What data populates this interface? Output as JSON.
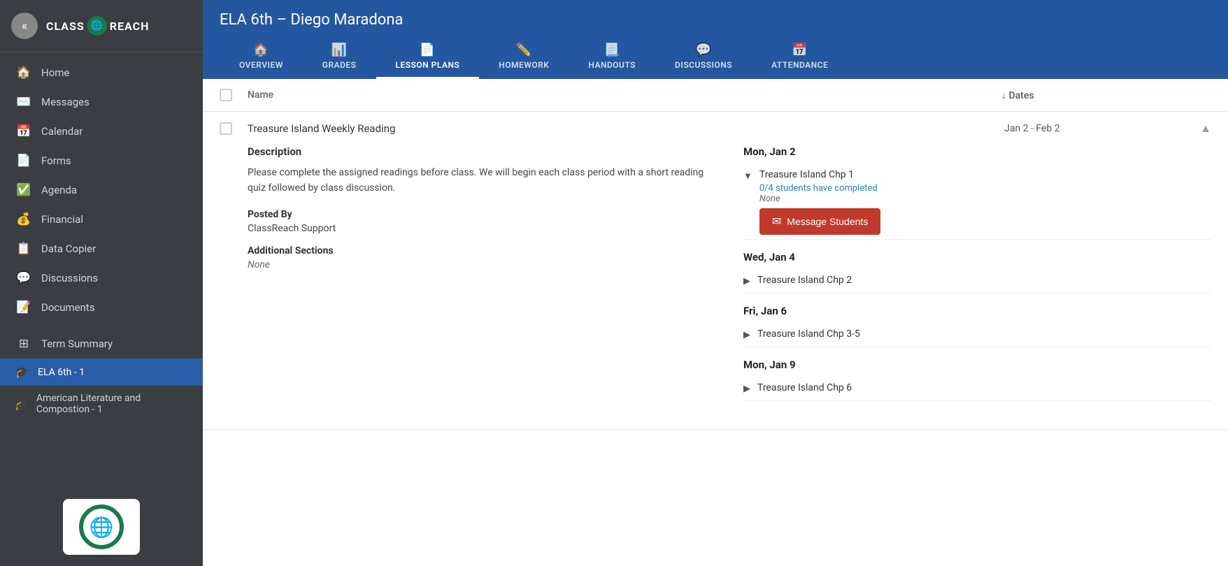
{
  "app": {
    "name": "CLASS REACH",
    "logo_symbol": "🌐"
  },
  "sidebar": {
    "back_title": "«",
    "nav_items": [
      {
        "id": "home",
        "label": "Home",
        "icon": "🏠"
      },
      {
        "id": "messages",
        "label": "Messages",
        "icon": "✉️"
      },
      {
        "id": "calendar",
        "label": "Calendar",
        "icon": "📅"
      },
      {
        "id": "forms",
        "label": "Forms",
        "icon": "📄"
      },
      {
        "id": "agenda",
        "label": "Agenda",
        "icon": "✅"
      },
      {
        "id": "financial",
        "label": "Financial",
        "icon": "💰"
      },
      {
        "id": "data_copier",
        "label": "Data Copier",
        "icon": "📋"
      },
      {
        "id": "discussions",
        "label": "Discussions",
        "icon": "💬"
      },
      {
        "id": "documents",
        "label": "Documents",
        "icon": "📝"
      }
    ],
    "term_summary_label": "Term Summary",
    "classes": [
      {
        "id": "ela6",
        "label": "ELA 6th - 1",
        "active": true
      },
      {
        "id": "amlit",
        "label": "American Literature and Compostion - 1",
        "active": false
      }
    ]
  },
  "header": {
    "title": "ELA 6th – Diego Maradona",
    "tabs": [
      {
        "id": "overview",
        "label": "OVERVIEW",
        "icon": "🏠"
      },
      {
        "id": "grades",
        "label": "GRADES",
        "icon": "📊"
      },
      {
        "id": "lesson_plans",
        "label": "LESSON PLANS",
        "icon": "📄",
        "active": true
      },
      {
        "id": "homework",
        "label": "HOMEWORK",
        "icon": "✏️"
      },
      {
        "id": "handouts",
        "label": "HANDOUTS",
        "icon": "📃"
      },
      {
        "id": "discussions",
        "label": "DISCUSSIONS",
        "icon": "💬"
      },
      {
        "id": "attendance",
        "label": "ATTENDANCE",
        "icon": "📅"
      }
    ]
  },
  "table": {
    "col_name": "Name",
    "col_dates_label": "↓ Dates"
  },
  "lesson": {
    "name": "Treasure Island Weekly Reading",
    "dates": "Jan 2 - Feb 2",
    "description_title": "Description",
    "description_text": "Please complete the assigned readings before class. We will begin each class period with a short reading quiz followed by class discussion.",
    "posted_by_label": "Posted By",
    "posted_by_value": "ClassReach Support",
    "additional_sections_label": "Additional Sections",
    "additional_sections_value": "None",
    "schedule": [
      {
        "day": "Mon, Jan 2",
        "items": [
          {
            "name": "Treasure Island Chp 1",
            "completed_text": "0/4 students have completed",
            "none_text": "None",
            "has_button": true
          }
        ]
      },
      {
        "day": "Wed, Jan 4",
        "items": [
          {
            "name": "Treasure Island Chp 2",
            "has_button": false
          }
        ]
      },
      {
        "day": "Fri, Jan 6",
        "items": [
          {
            "name": "Treasure Island Chp 3-5",
            "has_button": false
          }
        ]
      },
      {
        "day": "Mon, Jan 9",
        "items": [
          {
            "name": "Treasure Island Chp 6",
            "has_button": false
          }
        ]
      }
    ],
    "message_btn_label": "Message Students"
  }
}
